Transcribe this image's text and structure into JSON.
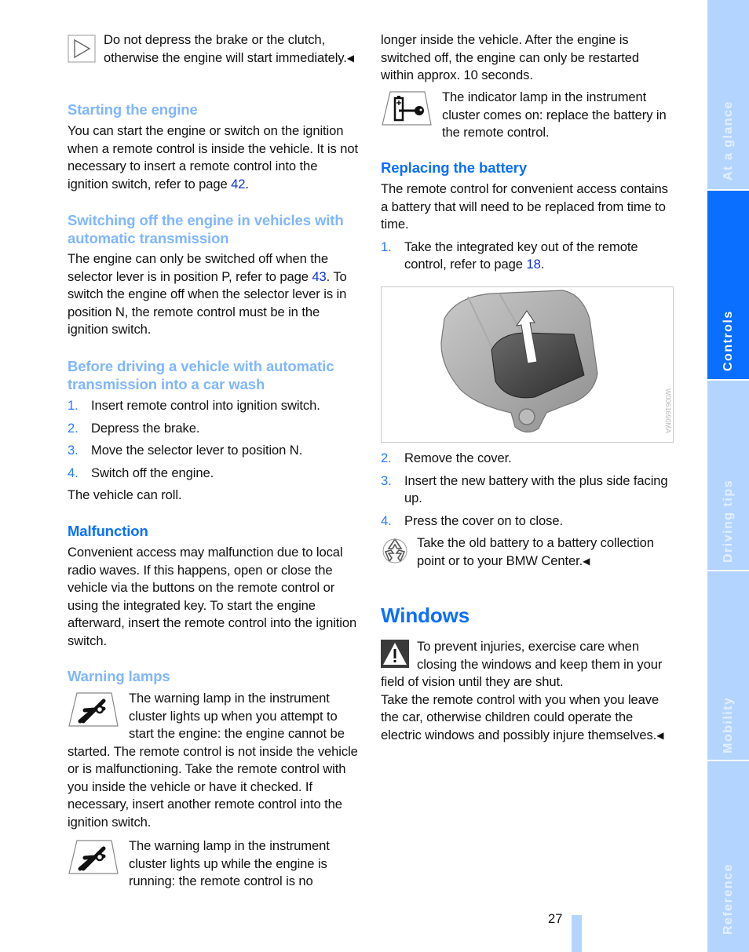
{
  "left_column": {
    "note_intro": {
      "icon": "note-triangle-icon",
      "text": "Do not depress the brake or the clutch, otherwise the engine will start immedi­ately.",
      "end_mark": "◀"
    },
    "starting_engine": {
      "heading": "Starting the engine",
      "text_before": "You can start the engine or switch on the igni­tion when a remote control is inside the vehicle. It is not necessary to insert a remote control into the ignition switch, refer to page ",
      "link": "42",
      "text_after": "."
    },
    "switching_off": {
      "heading": "Switching off the engine in vehicles with automatic transmission",
      "text_before": "The engine can only be switched off when the selector lever is in position P, refer to page ",
      "link": "43",
      "text_after": ". To switch the engine off when the selector lever is in position N, the remote control must be in the ignition switch."
    },
    "car_wash": {
      "heading": "Before driving a vehicle with automatic transmission into a car wash",
      "steps": [
        {
          "num": "1.",
          "text": "Insert remote control into ignition switch."
        },
        {
          "num": "2.",
          "text": "Depress the brake."
        },
        {
          "num": "3.",
          "text": "Move the selector lever to position N."
        },
        {
          "num": "4.",
          "text": "Switch off the engine."
        }
      ],
      "after": "The vehicle can roll."
    },
    "malfunction": {
      "heading": "Malfunction",
      "text": "Convenient access may malfunction due to local radio waves. If this happens, open or close the vehicle via the buttons on the remote con­trol or using the integrated key. To start the engine afterward, insert the remote control into the ignition switch."
    },
    "warning_lamps": {
      "heading": "Warning lamps",
      "lamp1": {
        "icon": "key-warning-lamp-icon",
        "text": "The warning lamp in the instrument cluster lights up when you attempt to start the engine: the engine cannot be started. The remote control is not inside the vehicle or is malfunctioning. Take the remote control with you inside the vehicle or have it checked. If necessary, insert another remote control into the ignition switch."
      },
      "lamp2": {
        "icon": "key-warning-lamp-icon",
        "text": "The warning lamp in the instrument cluster lights up while the engine is running: the remote control is no"
      }
    }
  },
  "right_column": {
    "continued_text": "longer inside the vehicle. After the engine is switched off, the engine can only be restarted within approx. 10 seconds.",
    "battery_lamp": {
      "icon": "battery-key-indicator-icon",
      "text": "The indicator lamp in the instrument cluster comes on: replace the battery in the remote control."
    },
    "replacing_battery": {
      "heading": "Replacing the battery",
      "intro": "The remote control for convenient access con­tains a battery that will need to be replaced from time to time.",
      "step1": {
        "num": "1.",
        "text_before": "Take the integrated key out of the remote control, refer to page ",
        "link": "18",
        "text_after": "."
      },
      "figure": {
        "alt": "Remote control with battery cover being removed, arrow pointing up",
        "code": "W0061690MA"
      },
      "steps": [
        {
          "num": "2.",
          "text": "Remove the cover."
        },
        {
          "num": "3.",
          "text": "Insert the new battery with the plus side fac­ing up."
        },
        {
          "num": "4.",
          "text": "Press the cover on to close."
        }
      ],
      "recycle_note": {
        "icon": "recycle-icon",
        "text": "Take the old battery to a battery collec­tion point or to your BMW Center.",
        "end_mark": "◀"
      }
    },
    "windows": {
      "heading": "Windows",
      "warning": {
        "icon": "warning-triangle-icon",
        "text1": "To prevent injuries, exercise care when closing the windows and keep them in your field of vision until they are shut.",
        "text2": "Take the remote control with you when you leave the car, otherwise children could operate the electric windows and possibly injure them­selves.",
        "end_mark": "◀"
      }
    }
  },
  "side_tabs": [
    {
      "label": "At a glance",
      "active": false
    },
    {
      "label": "Controls",
      "active": true
    },
    {
      "label": "Driving tips",
      "active": false
    },
    {
      "label": "Mobility",
      "active": false
    },
    {
      "label": "Reference",
      "active": false
    }
  ],
  "colors": {
    "heading_light": "#7fb6ff",
    "heading_dark": "#0a6fff",
    "tab_inactive": "#b3d4ff",
    "tab_active": "#0a6fff",
    "link": "#0b30d8"
  },
  "page_number": "27"
}
